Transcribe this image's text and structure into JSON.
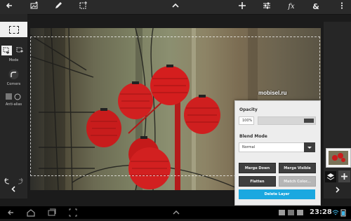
{
  "toolbar": {
    "icons": [
      "back-arrow-icon",
      "add-image-icon",
      "brush-icon",
      "select-tool-icon",
      "chevron-up-icon",
      "plus-icon",
      "adjustments-icon",
      "fx-icon",
      "ampersand-icon",
      "menu-icon"
    ],
    "fx_label": "fx",
    "amp_label": "&"
  },
  "left_panel": {
    "mode_label": "Mode",
    "corners_label": "Corners",
    "antialias_label": "Anti-alias"
  },
  "layers_panel": {
    "opacity_label": "Opacity",
    "opacity_value": "100%",
    "opacity_level": 1.0,
    "blend_label": "Blend Mode",
    "blend_value": "Normal",
    "buttons": {
      "merge_down": "Merge Down",
      "merge_visible": "Merge Visible",
      "flatten": "Flatten",
      "match_color": "Match Color..."
    },
    "delete_label": "Delete Layer"
  },
  "watermark": "mobisel.ru",
  "status": {
    "time": "23:28"
  },
  "colors": {
    "accent": "#1ba8e0",
    "lantern": "#c81c1c"
  }
}
